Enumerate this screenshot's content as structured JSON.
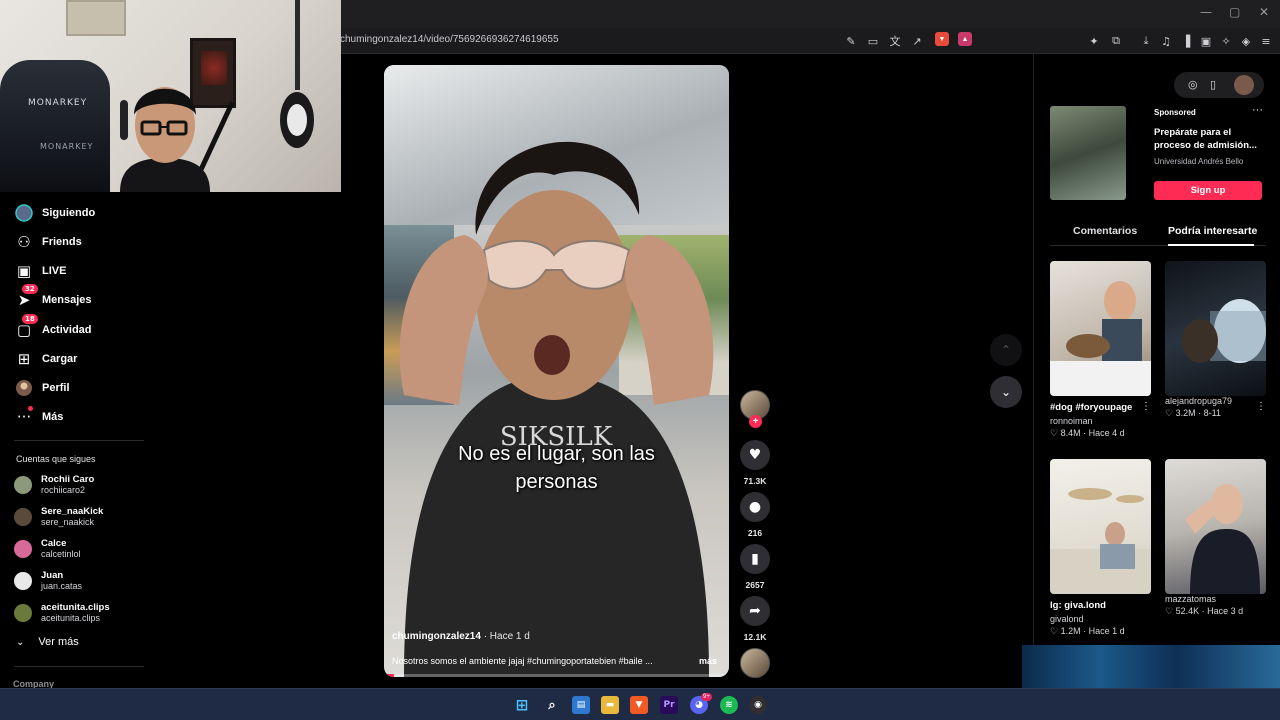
{
  "browser": {
    "url": "chumingonzalez14/video/7569266936274619655",
    "toolbar_icons": [
      "reader-icon",
      "cast-icon",
      "translate-icon",
      "share-icon",
      "brave-shield-icon",
      "brave-rewards-icon",
      "extensions-icon",
      "downloads-icon",
      "media-icon",
      "sidebar-icon",
      "wallet-icon",
      "leo-icon",
      "vpn-icon",
      "menu-icon"
    ],
    "window_controls": [
      "—",
      "▢",
      "✕"
    ]
  },
  "sidebar": {
    "nav": [
      {
        "label": "Siguiendo",
        "icon": "following-avatar-icon"
      },
      {
        "label": "Friends",
        "icon": "friends-icon"
      },
      {
        "label": "LIVE",
        "icon": "live-tv-icon"
      },
      {
        "label": "Mensajes",
        "icon": "messages-icon",
        "badge": "32"
      },
      {
        "label": "Actividad",
        "icon": "activity-icon",
        "badge": "18"
      },
      {
        "label": "Cargar",
        "icon": "upload-icon"
      },
      {
        "label": "Perfil",
        "icon": "profile-icon"
      },
      {
        "label": "Más",
        "icon": "more-icon",
        "dot": true
      }
    ],
    "following_title": "Cuentas que sigues",
    "accounts": [
      {
        "name": "Rochii Caro",
        "handle": "rochiicaro2",
        "color": "#8a9a7a"
      },
      {
        "name": "Sere_naaKick",
        "handle": "sere_naakick",
        "color": "#5a4a3a"
      },
      {
        "name": "Calce",
        "handle": "calcetinlol",
        "color": "#d86a9a"
      },
      {
        "name": "Juan",
        "handle": "juan.catas",
        "color": "#e8e8e8"
      },
      {
        "name": "aceitunita.clips",
        "handle": "aceitunita.clips",
        "color": "#6a7a3a"
      }
    ],
    "see_more": "Ver más",
    "company": "Company"
  },
  "video": {
    "subtitle_line1": "No es el lugar, son las",
    "subtitle_line2": "personas",
    "author": "chumingonzalez14",
    "time": "Hace 1 d",
    "description": "Nosotros somos el ambiente jajaj #chumingoportatebien #baile ...",
    "more": "más",
    "progress": 0.03
  },
  "actions": {
    "likes": "71.3K",
    "comments": "216",
    "saves": "2657",
    "shares": "12.1K"
  },
  "right_panel": {
    "ad": {
      "sponsored": "Sponsored",
      "title": "Prepárate para el proceso de admisión...",
      "advertiser": "Universidad Andrés Bello",
      "cta": "Sign up"
    },
    "tabs": [
      "Comentarios",
      "Podría interesarte"
    ],
    "active_tab": "Podría interesarte",
    "recommendations": [
      {
        "title": "#dog #foryoupage",
        "author": "ronnoiman",
        "likes": "8.4M",
        "time": "Hace 4 d"
      },
      {
        "title": "",
        "author": "alejandropuga79",
        "likes": "3.2M",
        "time": "8-11"
      },
      {
        "title": "lg: giva.lond",
        "author": "givalond",
        "likes": "1.2M",
        "time": "Hace 1 d"
      },
      {
        "title": "",
        "author": "mazzatomas",
        "likes": "52.4K",
        "time": "Hace 3 d"
      }
    ]
  },
  "taskbar": {
    "icons": [
      "windows-start-icon",
      "search-icon",
      "widgets-icon",
      "file-explorer-icon",
      "brave-browser-icon",
      "premiere-icon",
      "discord-icon",
      "spotify-icon",
      "obs-icon"
    ],
    "discord_badge": "9+"
  },
  "colors": {
    "accent": "#fe2c55",
    "background": "#000000",
    "panel": "#1f1f22"
  }
}
